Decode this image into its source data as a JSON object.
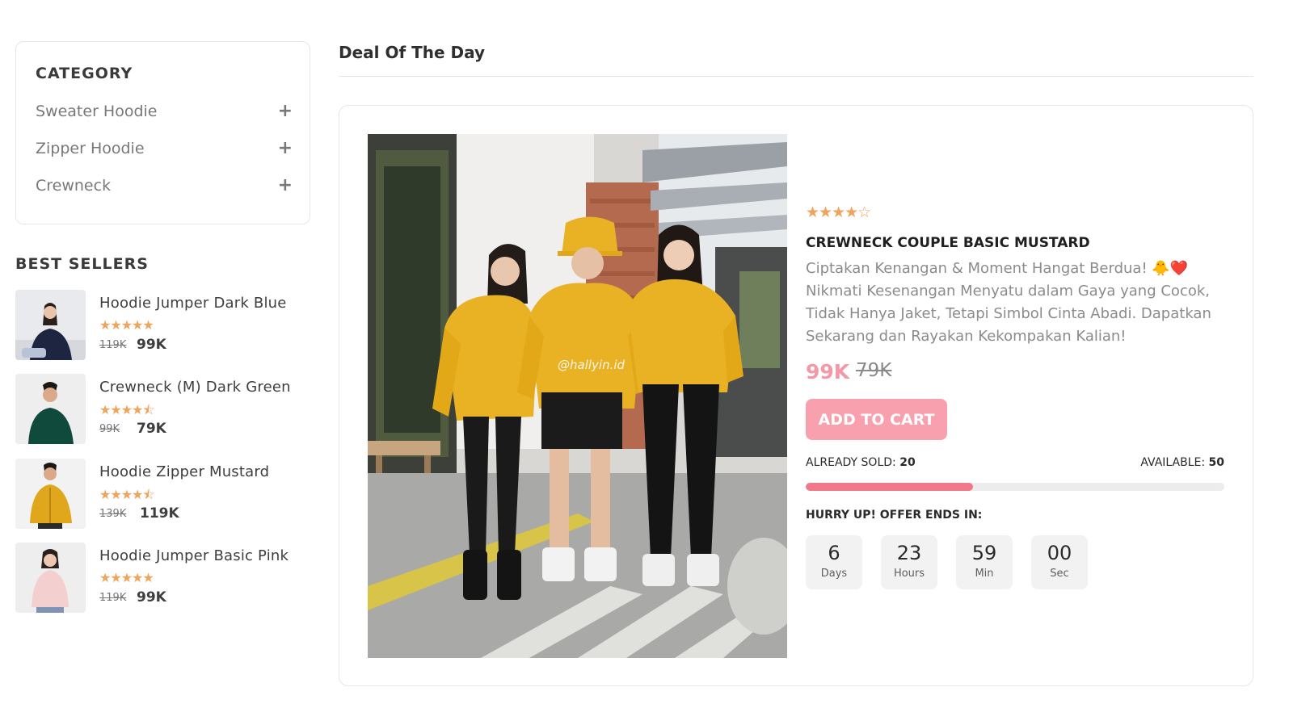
{
  "sidebar": {
    "category_title": "CATEGORY",
    "categories": [
      {
        "label": "Sweater Hoodie",
        "expand_icon": "+"
      },
      {
        "label": "Zipper Hoodie",
        "expand_icon": "+"
      },
      {
        "label": "Crewneck",
        "expand_icon": "+"
      }
    ],
    "best_sellers_title": "BEST SELLERS",
    "best_sellers": [
      {
        "name": "Hoodie Jumper Dark Blue",
        "stars": "★★★★★",
        "rating": 5,
        "old_price": "119K",
        "price": "99K",
        "shirt_color": "#1e2540"
      },
      {
        "name": "Crewneck (M) Dark Green",
        "stars": "★★★★⯪",
        "rating": 4.5,
        "old_price": "99K",
        "price": "79K",
        "shirt_color": "#0f4a3c"
      },
      {
        "name": "Hoodie Zipper Mustard",
        "stars": "★★★★⯪",
        "rating": 4.5,
        "old_price": "139K",
        "price": "119K",
        "shirt_color": "#e0a61c"
      },
      {
        "name": "Hoodie Jumper Basic Pink",
        "stars": "★★★★★",
        "rating": 5,
        "old_price": "119K",
        "price": "99K",
        "shirt_color": "#f4cfd0"
      }
    ]
  },
  "deal": {
    "section_title": "Deal Of The Day",
    "image_watermark": "@hallyin.id",
    "stars": "★★★★☆",
    "rating": 4,
    "product_name": "CREWNECK COUPLE BASIC MUSTARD",
    "description_line1": "Ciptakan Kenangan & Moment Hangat Berdua! 🐥❤️",
    "description_rest": "Nikmati Kesenangan Menyatu dalam Gaya yang Cocok, Tidak Hanya Jaket, Tetapi Simbol Cinta Abadi. Dapatkan Sekarang dan Rayakan Kekompakan Kalian!",
    "price": "99K",
    "old_price": "79K",
    "add_to_cart_label": "ADD TO CART",
    "sold_label": "ALREADY SOLD:",
    "sold_value": "20",
    "available_label": "AVAILABLE:",
    "available_value": "50",
    "sold_fraction": 0.4,
    "hurry_label": "HURRY UP! OFFER ENDS IN:",
    "countdown": [
      {
        "value": "6",
        "unit": "Days"
      },
      {
        "value": "23",
        "unit": "Hours"
      },
      {
        "value": "59",
        "unit": "Min"
      },
      {
        "value": "00",
        "unit": "Sec"
      }
    ]
  },
  "colors": {
    "accent_pink": "#f8a0ad",
    "progress_fill": "#f0788a",
    "star": "#f0a35a",
    "mustard": "#e9b124"
  }
}
